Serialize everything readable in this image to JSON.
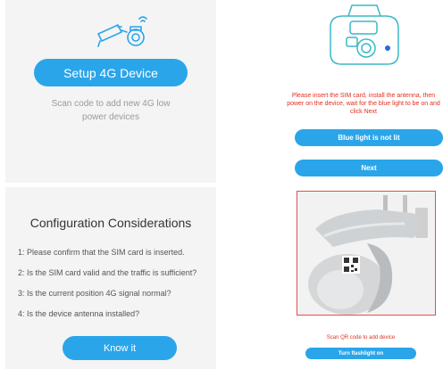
{
  "setup": {
    "button_label": "Setup 4G Device",
    "hint": "Scan code to add new 4G low power devices"
  },
  "insert": {
    "instruction": "Please insert the SIM card, install the antenna, then power on the device, wait for the blue light to be on and click Next",
    "not_lit_label": "Blue light is not lit",
    "next_label": "Next"
  },
  "config": {
    "title": "Configuration Considerations",
    "items": [
      "1: Please confirm that the SIM card is inserted.",
      "2: Is the SIM card valid and the traffic is sufficient?",
      "3: Is the current position 4G signal normal?",
      "4: Is the device antenna installed?"
    ],
    "button_label": "Know it"
  },
  "scan": {
    "hint": "Scan QR code to add device",
    "flash_label": "Turn flashlight on"
  },
  "colors": {
    "accent": "#2aa5ea",
    "warning_text": "#e03020"
  }
}
